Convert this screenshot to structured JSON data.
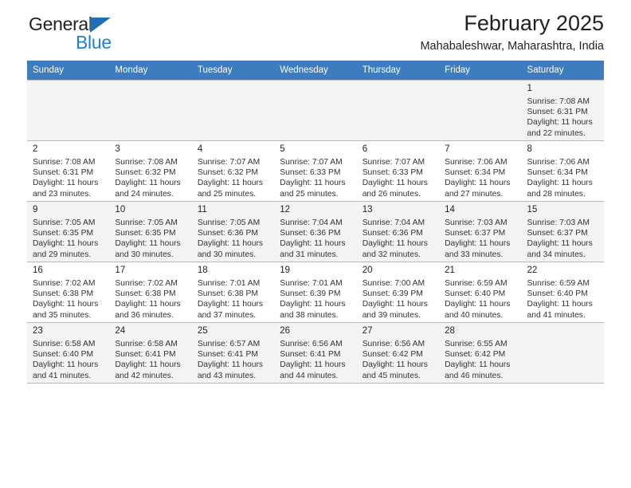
{
  "brand": {
    "name_top": "General",
    "name_bottom": "Blue",
    "accent_color": "#1f7fd0",
    "triangle_color": "#1f6fb5"
  },
  "header": {
    "title": "February 2025",
    "subtitle": "Mahabaleshwar, Maharashtra, India"
  },
  "calendar": {
    "header_background": "#3d7cbf",
    "weekdays": [
      "Sunday",
      "Monday",
      "Tuesday",
      "Wednesday",
      "Thursday",
      "Friday",
      "Saturday"
    ],
    "weeks": [
      [
        {
          "day": "",
          "info": ""
        },
        {
          "day": "",
          "info": ""
        },
        {
          "day": "",
          "info": ""
        },
        {
          "day": "",
          "info": ""
        },
        {
          "day": "",
          "info": ""
        },
        {
          "day": "",
          "info": ""
        },
        {
          "day": "1",
          "info": "Sunrise: 7:08 AM\nSunset: 6:31 PM\nDaylight: 11 hours\nand 22 minutes."
        }
      ],
      [
        {
          "day": "2",
          "info": "Sunrise: 7:08 AM\nSunset: 6:31 PM\nDaylight: 11 hours\nand 23 minutes."
        },
        {
          "day": "3",
          "info": "Sunrise: 7:08 AM\nSunset: 6:32 PM\nDaylight: 11 hours\nand 24 minutes."
        },
        {
          "day": "4",
          "info": "Sunrise: 7:07 AM\nSunset: 6:32 PM\nDaylight: 11 hours\nand 25 minutes."
        },
        {
          "day": "5",
          "info": "Sunrise: 7:07 AM\nSunset: 6:33 PM\nDaylight: 11 hours\nand 25 minutes."
        },
        {
          "day": "6",
          "info": "Sunrise: 7:07 AM\nSunset: 6:33 PM\nDaylight: 11 hours\nand 26 minutes."
        },
        {
          "day": "7",
          "info": "Sunrise: 7:06 AM\nSunset: 6:34 PM\nDaylight: 11 hours\nand 27 minutes."
        },
        {
          "day": "8",
          "info": "Sunrise: 7:06 AM\nSunset: 6:34 PM\nDaylight: 11 hours\nand 28 minutes."
        }
      ],
      [
        {
          "day": "9",
          "info": "Sunrise: 7:05 AM\nSunset: 6:35 PM\nDaylight: 11 hours\nand 29 minutes."
        },
        {
          "day": "10",
          "info": "Sunrise: 7:05 AM\nSunset: 6:35 PM\nDaylight: 11 hours\nand 30 minutes."
        },
        {
          "day": "11",
          "info": "Sunrise: 7:05 AM\nSunset: 6:36 PM\nDaylight: 11 hours\nand 30 minutes."
        },
        {
          "day": "12",
          "info": "Sunrise: 7:04 AM\nSunset: 6:36 PM\nDaylight: 11 hours\nand 31 minutes."
        },
        {
          "day": "13",
          "info": "Sunrise: 7:04 AM\nSunset: 6:36 PM\nDaylight: 11 hours\nand 32 minutes."
        },
        {
          "day": "14",
          "info": "Sunrise: 7:03 AM\nSunset: 6:37 PM\nDaylight: 11 hours\nand 33 minutes."
        },
        {
          "day": "15",
          "info": "Sunrise: 7:03 AM\nSunset: 6:37 PM\nDaylight: 11 hours\nand 34 minutes."
        }
      ],
      [
        {
          "day": "16",
          "info": "Sunrise: 7:02 AM\nSunset: 6:38 PM\nDaylight: 11 hours\nand 35 minutes."
        },
        {
          "day": "17",
          "info": "Sunrise: 7:02 AM\nSunset: 6:38 PM\nDaylight: 11 hours\nand 36 minutes."
        },
        {
          "day": "18",
          "info": "Sunrise: 7:01 AM\nSunset: 6:38 PM\nDaylight: 11 hours\nand 37 minutes."
        },
        {
          "day": "19",
          "info": "Sunrise: 7:01 AM\nSunset: 6:39 PM\nDaylight: 11 hours\nand 38 minutes."
        },
        {
          "day": "20",
          "info": "Sunrise: 7:00 AM\nSunset: 6:39 PM\nDaylight: 11 hours\nand 39 minutes."
        },
        {
          "day": "21",
          "info": "Sunrise: 6:59 AM\nSunset: 6:40 PM\nDaylight: 11 hours\nand 40 minutes."
        },
        {
          "day": "22",
          "info": "Sunrise: 6:59 AM\nSunset: 6:40 PM\nDaylight: 11 hours\nand 41 minutes."
        }
      ],
      [
        {
          "day": "23",
          "info": "Sunrise: 6:58 AM\nSunset: 6:40 PM\nDaylight: 11 hours\nand 41 minutes."
        },
        {
          "day": "24",
          "info": "Sunrise: 6:58 AM\nSunset: 6:41 PM\nDaylight: 11 hours\nand 42 minutes."
        },
        {
          "day": "25",
          "info": "Sunrise: 6:57 AM\nSunset: 6:41 PM\nDaylight: 11 hours\nand 43 minutes."
        },
        {
          "day": "26",
          "info": "Sunrise: 6:56 AM\nSunset: 6:41 PM\nDaylight: 11 hours\nand 44 minutes."
        },
        {
          "day": "27",
          "info": "Sunrise: 6:56 AM\nSunset: 6:42 PM\nDaylight: 11 hours\nand 45 minutes."
        },
        {
          "day": "28",
          "info": "Sunrise: 6:55 AM\nSunset: 6:42 PM\nDaylight: 11 hours\nand 46 minutes."
        },
        {
          "day": "",
          "info": ""
        }
      ]
    ]
  }
}
